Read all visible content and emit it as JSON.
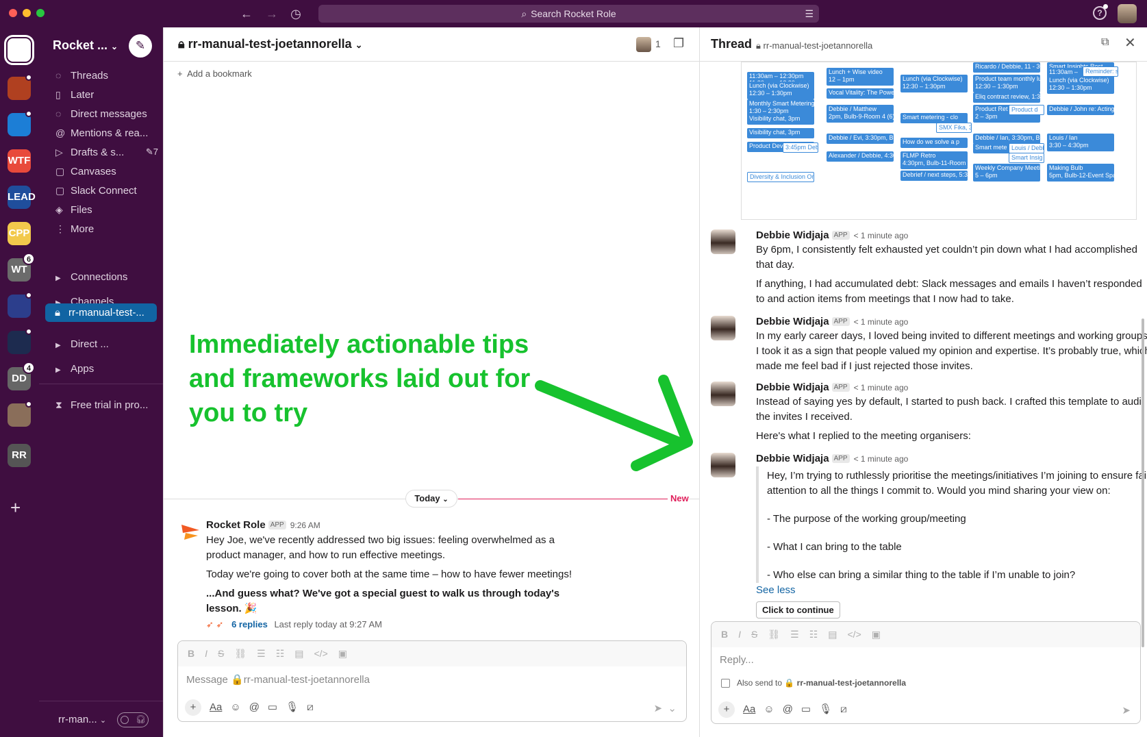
{
  "search": {
    "placeholder": "Search Rocket Role"
  },
  "workspace": {
    "name": "Rocket ...",
    "footer_name": "rr-man..."
  },
  "rail": {
    "items": [
      {
        "label": "",
        "color": "#f15a24"
      },
      {
        "label": "",
        "color": "#b04020"
      },
      {
        "label": "",
        "color": "#1c7ed6"
      },
      {
        "label": "WTF",
        "color": "#e84a3b"
      },
      {
        "label": "LEAD",
        "color": "#1f4e9c"
      },
      {
        "label": "CPP",
        "color": "#f2c94c"
      },
      {
        "label": "WT",
        "color": "#6b6b6b",
        "badge": "6"
      },
      {
        "label": "",
        "color": "#2c3e8c"
      },
      {
        "label": "",
        "color": "#1d2b4f"
      },
      {
        "label": "DD",
        "color": "#666666",
        "badge": "4"
      },
      {
        "label": "",
        "color": "#8a6e5a"
      },
      {
        "label": "RR",
        "color": "#555555"
      }
    ]
  },
  "sidebar": {
    "nav": [
      {
        "label": "Threads",
        "icon": "threads-icon",
        "glyph": "◌"
      },
      {
        "label": "Later",
        "icon": "bookmark-icon",
        "glyph": "▯"
      },
      {
        "label": "Direct messages",
        "icon": "dm-icon",
        "glyph": "◌"
      },
      {
        "label": "Mentions & rea...",
        "icon": "at-icon",
        "glyph": "@"
      },
      {
        "label": "Drafts & s...",
        "icon": "send-icon",
        "glyph": "▷",
        "count": "✎7"
      },
      {
        "label": "Canvases",
        "icon": "canvas-icon",
        "glyph": "▢"
      },
      {
        "label": "Slack Connect",
        "icon": "connect-icon",
        "glyph": "▢"
      },
      {
        "label": "Files",
        "icon": "files-icon",
        "glyph": "◈"
      },
      {
        "label": "More",
        "icon": "more-icon",
        "glyph": "⋮"
      }
    ],
    "sections": {
      "connections": "Connections",
      "channels": "Channels",
      "direct": "Direct ...",
      "apps": "Apps"
    },
    "active_channel": "rr-manual-test-...",
    "trial": "Free trial in pro..."
  },
  "channel": {
    "name": "rr-manual-test-joetannorella",
    "member_count": "1",
    "add_bookmark": "Add a bookmark",
    "promo_text": "Immediately actionable tips and frameworks laid out for you to try",
    "today": "Today",
    "new_label": "New",
    "message": {
      "author": "Rocket Role",
      "app_tag": "APP",
      "time": "9:26 AM",
      "p1": "Hey Joe, we've recently addressed two big issues: feeling overwhelmed as a product manager, and how to run effective meetings.",
      "p2": "Today we're going to cover both at the same time – how to have fewer meetings!",
      "p3": "...And guess what? We've got a special guest to walk us through today's lesson. 🎉",
      "replies": "6 replies",
      "last_reply": "Last reply today at 9:27 AM"
    },
    "composer_placeholder": "Message 🔒rr-manual-test-joetannorella"
  },
  "thread": {
    "title": "Thread",
    "channel": "rr-manual-test-joetannorella",
    "calendar_events": [
      "11:30am – 12:30pm",
      "Lunch (via Clockwise)",
      "12:30 – 1:30pm",
      "Monthly Smart Metering",
      "1:30 – 2:30pm",
      "Visibility chat, 3pm",
      "Product Dev",
      "3:45pm Debb",
      "Diversity & Inclusion Onb",
      "Lunch + Wise video",
      "12 – 1pm",
      "Vocal Vitality: The Powe",
      "Debbie / Matthew",
      "2pm, Bulb-9-Room 4 (6)",
      "Debbie / Evi, 3:30pm, Bu",
      "Alexander / Debbie, 4:30",
      "Lunch (via Clockwise)",
      "12:30 – 1:30pm",
      "Smart metering - clo",
      "SMX Fika, 3",
      "How do we solve a p",
      "FLMP Retro",
      "4:30pm, Bulb-11-Room 1",
      "Debrief / next steps, 5:3",
      "Ricardo / Debbie, 11 - 30",
      "Product team monthly lu",
      "12:30 – 1:30pm",
      "Eliq contract review, 1:30",
      "Product Ret",
      "2 – 3pm",
      "Product d",
      "Debbie / Ian, 3:30pm, Bu",
      "Smart mete",
      "Louis / Debb",
      "Smart Insig",
      "Weekly Company Meetin",
      "5 – 6pm",
      "Smart Insights Rest",
      "11:30am –",
      "Reminder: s",
      "Lunch (via Clockwise)",
      "12:30 – 1:30pm",
      "Debbie / John re: Acting",
      "Louis / Ian",
      "3:30 – 4:30pm",
      "Making Bulb",
      "5pm, Bulb-12-Event Spac"
    ],
    "messages": [
      {
        "author": "Debbie Widjaja",
        "tag": "APP",
        "time": "< 1 minute ago",
        "p1": "By 6pm, I consistently felt exhausted yet couldn’t pin down what I had accomplished that day.",
        "p2": "If anything, I had accumulated debt: Slack messages and emails I haven’t responded to and action items from meetings that I now had to take."
      },
      {
        "author": "Debbie Widjaja",
        "tag": "APP",
        "time": "< 1 minute ago",
        "p1": "In my early career days, I loved being invited to different meetings and working groups. I took it as a sign that people valued my opinion and expertise. It’s probably true, which made me feel bad if I just rejected those invites."
      },
      {
        "author": "Debbie Widjaja",
        "tag": "APP",
        "time": "< 1 minute ago",
        "p1": "Instead of saying yes by default, I started to push back. I crafted this template to audit the invites I received.",
        "p2": "Here's what I replied to the meeting organisers:"
      },
      {
        "author": "Debbie Widjaja",
        "tag": "APP",
        "time": "< 1 minute ago",
        "q1": "Hey, I’m trying to ruthlessly prioritise the meetings/initiatives I’m joining to ensure fair attention to all the things I commit to. Would you mind sharing your view on:",
        "q2": "- The purpose of the working group/meeting",
        "q3": "- What I can bring to the table",
        "q4": "- Who else can bring a similar thing to the table if I’m unable to join?",
        "see_less": "See less",
        "button": "Click to continue"
      }
    ],
    "reply_placeholder": "Reply...",
    "also_send": "Also send to",
    "also_send_channel": "🔒 rr-manual-test-joetannorella"
  },
  "colors": {
    "sidebar_bg": "#3f0e40",
    "active_channel": "#1164a3",
    "promo_green": "#17c22e",
    "new_red": "#e01e5a",
    "link_blue": "#1264a3"
  }
}
